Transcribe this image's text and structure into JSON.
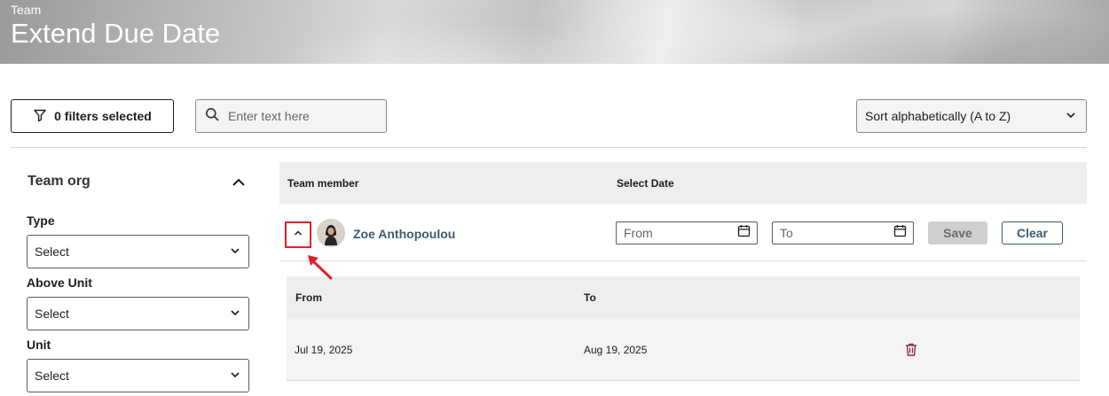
{
  "header": {
    "kicker": "Team",
    "title": "Extend Due Date"
  },
  "toolbar": {
    "filters_label": "0 filters selected",
    "search_placeholder": "Enter text here",
    "sort_selected": "Sort alphabetically (A to Z)"
  },
  "sidebar": {
    "section_title": "Team org",
    "fields": [
      {
        "label": "Type",
        "value": "Select"
      },
      {
        "label": "Above Unit",
        "value": "Select"
      },
      {
        "label": "Unit",
        "value": "Select"
      }
    ]
  },
  "table": {
    "columns": [
      "Team member",
      "Select Date"
    ],
    "rows": [
      {
        "name": "Zoe Anthopoulou",
        "from_placeholder": "From",
        "to_placeholder": "To",
        "save_label": "Save",
        "clear_label": "Clear",
        "history": {
          "columns": [
            "From",
            "To"
          ],
          "rows": [
            {
              "from": "Jul 19, 2025",
              "to": "Aug 19, 2025"
            }
          ]
        }
      }
    ]
  },
  "colors": {
    "link": "#3b5b73",
    "highlight": "#e0202a",
    "trash": "#8b2a4a"
  },
  "icons": [
    "filter-icon",
    "search-icon",
    "chevron-down-icon",
    "chevron-up-icon",
    "calendar-icon",
    "trash-icon",
    "arrow-annotation"
  ]
}
